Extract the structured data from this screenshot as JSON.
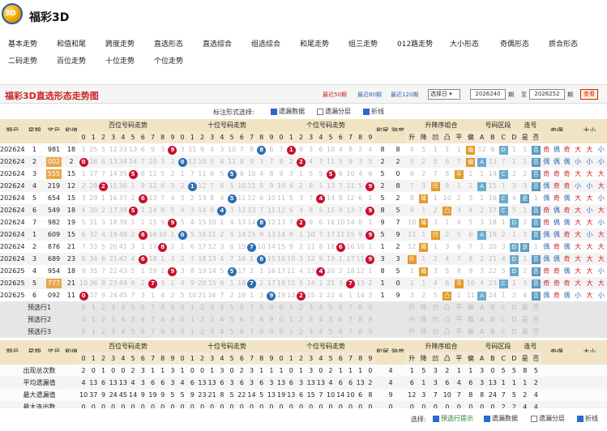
{
  "app": {
    "title": "福彩3D",
    "logo_text": "3D"
  },
  "nav": {
    "row1": [
      "基本走势",
      "和值和尾",
      "跨度走势",
      "直选形态",
      "直选综合",
      "组选综合",
      "和尾走势",
      "组三走势",
      "012路走势",
      "大小形态",
      "奇偶形态",
      "质合形态"
    ],
    "row2": [
      "二码走势",
      "百位走势",
      "十位走势",
      "个位走势"
    ]
  },
  "header": {
    "title": "福彩3D直选形态走势图",
    "periods": [
      "最近50期",
      "最近80期",
      "最近120期"
    ],
    "select_label": "选择日",
    "from_label": "期",
    "to_label": "至",
    "to_suffix": "期",
    "from": "2026240",
    "to": "2026252",
    "query": "查看"
  },
  "options": {
    "label": "标注形式选择:",
    "items": [
      {
        "label": "遗漏数据",
        "checked": true
      },
      {
        "label": "遗漏分层",
        "checked": false
      },
      {
        "label": "折线",
        "checked": true
      }
    ]
  },
  "columns": {
    "period": "期号",
    "week": "星期",
    "prize": "奖号",
    "sum": "和值",
    "hundreds": "百位号码走势",
    "tens": "十位号码走势",
    "units": "个位号码走势",
    "sum_tail": "和尾",
    "span": "跨度",
    "order": "升降序组合",
    "zone": "号码区段",
    "consec": "连号",
    "oddeven": "奇偶",
    "bigsmall": "大小",
    "digits": [
      "0",
      "1",
      "2",
      "3",
      "4",
      "5",
      "6",
      "7",
      "8",
      "9"
    ],
    "order_sub": [
      "升",
      "降",
      "凹",
      "凸",
      "平",
      "偏"
    ],
    "zone_sub": [
      "A",
      "B",
      "C",
      "D"
    ],
    "consec_sub": [
      "是",
      "否"
    ]
  },
  "rows": [
    {
      "p": "2026240",
      "w": "1",
      "n": "981",
      "s": "18",
      "h": [
        "1",
        "25",
        "5",
        "12",
        "33",
        "13",
        "6",
        "9",
        "3",
        "9"
      ],
      "t": [
        "3",
        "11",
        "9",
        "4",
        "3",
        "10",
        "7",
        "8",
        "2",
        "6"
      ],
      "u": [
        "7",
        "1",
        "9",
        "3",
        "6",
        "10",
        "4",
        "8",
        "2",
        "4"
      ],
      "hw": "8",
      "sp": "8",
      "ord": [
        "4",
        "5",
        "1",
        "1",
        "1",
        "偏"
      ],
      "zn": [
        "12",
        "6",
        "D",
        "1"
      ],
      "cs": [
        "1",
        "否"
      ],
      "oe": [
        "奇",
        "偶",
        "奇"
      ],
      "bs": [
        "大",
        "大",
        "小"
      ]
    },
    {
      "p": "2026241",
      "w": "2",
      "n": "002",
      "s": "2",
      "h": [
        "0",
        "26",
        "6",
        "13",
        "34",
        "14",
        "7",
        "10",
        "3",
        "1"
      ],
      "t": [
        "0",
        "12",
        "10",
        "5",
        "4",
        "11",
        "8",
        "9",
        "3",
        "7"
      ],
      "u": [
        "8",
        "2",
        "2",
        "4",
        "7",
        "11",
        "5",
        "9",
        "3",
        "5"
      ],
      "hw": "2",
      "sp": "2",
      "ord": [
        "5",
        "2",
        "5",
        "6",
        "7",
        "偏"
      ],
      "zn": [
        "A",
        "13",
        "7",
        "1"
      ],
      "cs": [
        "1",
        "否"
      ],
      "oe": [
        "偶",
        "偶",
        "偶"
      ],
      "bs": [
        "小",
        "小",
        "小"
      ]
    },
    {
      "p": "2026242",
      "w": "3",
      "n": "555",
      "s": "15",
      "h": [
        "1",
        "27",
        "7",
        "14",
        "35",
        "5",
        "8",
        "11",
        "5",
        "2"
      ],
      "t": [
        "1",
        "7",
        "11",
        "6",
        "5",
        "5",
        "9",
        "10",
        "4",
        "8"
      ],
      "u": [
        "9",
        "3",
        "1",
        "5",
        "5",
        "12",
        "6",
        "10",
        "4",
        "6"
      ],
      "hw": "5",
      "sp": "0",
      "ord": [
        "6",
        "2",
        "7",
        "8",
        "平",
        "1"
      ],
      "zn": [
        "1",
        "14",
        "C",
        "2"
      ],
      "cs": [
        "2",
        "否"
      ],
      "oe": [
        "奇",
        "奇",
        "奇"
      ],
      "bs": [
        "大",
        "大",
        "大"
      ]
    },
    {
      "p": "2026243",
      "w": "4",
      "n": "219",
      "s": "12",
      "h": [
        "2",
        "28",
        "2",
        "15",
        "36",
        "1",
        "9",
        "12",
        "6",
        "3"
      ],
      "t": [
        "2",
        "1",
        "12",
        "7",
        "6",
        "1",
        "10",
        "11",
        "5",
        "9"
      ],
      "u": [
        "10",
        "4",
        "2",
        "6",
        "1",
        "13",
        "7",
        "11",
        "5",
        "9"
      ],
      "hw": "2",
      "sp": "8",
      "ord": [
        "7",
        "3",
        "凹",
        "9",
        "1",
        "2"
      ],
      "zn": [
        "A",
        "15",
        "1",
        "3"
      ],
      "cs": [
        "3",
        "否"
      ],
      "oe": [
        "偶",
        "奇",
        "奇"
      ],
      "bs": [
        "小",
        "小",
        "大"
      ]
    },
    {
      "p": "2026244",
      "w": "5",
      "n": "654",
      "s": "15",
      "h": [
        "3",
        "29",
        "1",
        "16",
        "37",
        "2",
        "6",
        "13",
        "7",
        "4"
      ],
      "t": [
        "3",
        "2",
        "13",
        "8",
        "4",
        "2",
        "11",
        "12",
        "6",
        "10"
      ],
      "u": [
        "11",
        "5",
        "3",
        "7",
        "4",
        "14",
        "8",
        "12",
        "6",
        "1"
      ],
      "hw": "5",
      "sp": "2",
      "ord": [
        "8",
        "降",
        "1",
        "10",
        "2",
        "3"
      ],
      "zn": [
        "1",
        "16",
        "C",
        "4"
      ],
      "cs": [
        "是",
        "1"
      ],
      "oe": [
        "偶",
        "奇",
        "偶"
      ],
      "bs": [
        "大",
        "大",
        "小"
      ]
    },
    {
      "p": "2026245",
      "w": "6",
      "n": "549",
      "s": "18",
      "h": [
        "4",
        "30",
        "2",
        "17",
        "38",
        "5",
        "1",
        "14",
        "8",
        "5"
      ],
      "t": [
        "4",
        "3",
        "14",
        "9",
        "4",
        "3",
        "12",
        "13",
        "7",
        "11"
      ],
      "u": [
        "12",
        "6",
        "4",
        "8",
        "5",
        "15",
        "9",
        "13",
        "7",
        "9"
      ],
      "hw": "8",
      "sp": "5",
      "ord": [
        "9",
        "1",
        "2",
        "凸",
        "3",
        "4"
      ],
      "zn": [
        "2",
        "17",
        "C",
        "5"
      ],
      "cs": [
        "1",
        "否"
      ],
      "oe": [
        "奇",
        "偶",
        "奇"
      ],
      "bs": [
        "大",
        "小",
        "大"
      ]
    },
    {
      "p": "2026246",
      "w": "7",
      "n": "982",
      "s": "19",
      "h": [
        "5",
        "31",
        "3",
        "18",
        "39",
        "1",
        "2",
        "15",
        "9",
        "9"
      ],
      "t": [
        "5",
        "4",
        "15",
        "10",
        "1",
        "4",
        "13",
        "14",
        "8",
        "12"
      ],
      "u": [
        "13",
        "7",
        "2",
        "9",
        "6",
        "16",
        "10",
        "14",
        "8",
        "1"
      ],
      "hw": "9",
      "sp": "7",
      "ord": [
        "10",
        "降",
        "3",
        "1",
        "4",
        "5"
      ],
      "zn": [
        "3",
        "18",
        "1",
        "D"
      ],
      "cs": [
        "2",
        "否"
      ],
      "oe": [
        "奇",
        "偶",
        "偶"
      ],
      "bs": [
        "大",
        "大",
        "小"
      ]
    },
    {
      "p": "2026247",
      "w": "1",
      "n": "609",
      "s": "15",
      "h": [
        "6",
        "32",
        "4",
        "19",
        "40",
        "2",
        "6",
        "16",
        "10",
        "1"
      ],
      "t": [
        "0",
        "5",
        "16",
        "11",
        "2",
        "5",
        "14",
        "15",
        "9",
        "13"
      ],
      "u": [
        "14",
        "8",
        "1",
        "10",
        "7",
        "17",
        "11",
        "15",
        "9",
        "9"
      ],
      "hw": "5",
      "sp": "9",
      "ord": [
        "11",
        "1",
        "凹",
        "2",
        "5",
        "6"
      ],
      "zn": [
        "A",
        "19",
        "2",
        "1"
      ],
      "cs": [
        "3",
        "否"
      ],
      "oe": [
        "偶",
        "偶",
        "奇"
      ],
      "bs": [
        "大",
        "小",
        "大"
      ]
    },
    {
      "p": "2026248",
      "w": "2",
      "n": "876",
      "s": "21",
      "h": [
        "7",
        "33",
        "5",
        "20",
        "41",
        "3",
        "1",
        "17",
        "8",
        "2"
      ],
      "t": [
        "1",
        "6",
        "17",
        "12",
        "3",
        "6",
        "15",
        "7",
        "10",
        "14"
      ],
      "u": [
        "15",
        "9",
        "2",
        "11",
        "8",
        "18",
        "6",
        "16",
        "10",
        "1"
      ],
      "hw": "1",
      "sp": "2",
      "ord": [
        "12",
        "降",
        "1",
        "3",
        "6",
        "7"
      ],
      "zn": [
        "1",
        "20",
        "3",
        "D"
      ],
      "cs": [
        "是",
        "1"
      ],
      "oe": [
        "偶",
        "奇",
        "偶"
      ],
      "bs": [
        "大",
        "大",
        "大"
      ]
    },
    {
      "p": "2026249",
      "w": "3",
      "n": "689",
      "s": "23",
      "h": [
        "8",
        "34",
        "6",
        "21",
        "42",
        "4",
        "6",
        "18",
        "1",
        "3"
      ],
      "t": [
        "2",
        "7",
        "18",
        "13",
        "4",
        "7",
        "16",
        "1",
        "8",
        "15"
      ],
      "u": [
        "16",
        "10",
        "3",
        "12",
        "9",
        "19",
        "1",
        "17",
        "11",
        "9"
      ],
      "hw": "3",
      "sp": "3",
      "ord": [
        "升",
        "1",
        "2",
        "4",
        "7",
        "8"
      ],
      "zn": [
        "2",
        "21",
        "4",
        "D"
      ],
      "cs": [
        "1",
        "否"
      ],
      "oe": [
        "偶",
        "偶",
        "奇"
      ],
      "bs": [
        "大",
        "大",
        "大"
      ]
    },
    {
      "p": "2026250",
      "w": "4",
      "n": "954",
      "s": "18",
      "h": [
        "9",
        "35",
        "7",
        "22",
        "43",
        "5",
        "1",
        "19",
        "2",
        "9"
      ],
      "t": [
        "3",
        "8",
        "19",
        "14",
        "5",
        "5",
        "17",
        "2",
        "1",
        "16"
      ],
      "u": [
        "17",
        "11",
        "4",
        "13",
        "4",
        "20",
        "2",
        "18",
        "12",
        "1"
      ],
      "hw": "8",
      "sp": "5",
      "ord": [
        "1",
        "降",
        "3",
        "5",
        "8",
        "9"
      ],
      "zn": [
        "3",
        "22",
        "5",
        "D"
      ],
      "cs": [
        "2",
        "否"
      ],
      "oe": [
        "奇",
        "奇",
        "偶"
      ],
      "bs": [
        "大",
        "大",
        "小"
      ]
    },
    {
      "p": "2026251",
      "w": "5",
      "n": "777",
      "s": "21",
      "h": [
        "10",
        "36",
        "8",
        "23",
        "44",
        "6",
        "2",
        "7",
        "3",
        "1"
      ],
      "t": [
        "4",
        "9",
        "20",
        "15",
        "6",
        "1",
        "18",
        "7",
        "2",
        "17"
      ],
      "u": [
        "18",
        "12",
        "5",
        "14",
        "1",
        "21",
        "3",
        "7",
        "13",
        "2"
      ],
      "hw": "1",
      "sp": "0",
      "ord": [
        "2",
        "1",
        "4",
        "6",
        "平",
        "10"
      ],
      "zn": [
        "4",
        "23",
        "C",
        "1"
      ],
      "cs": [
        "3",
        "否"
      ],
      "oe": [
        "奇",
        "奇",
        "奇"
      ],
      "bs": [
        "大",
        "大",
        "大"
      ]
    },
    {
      "p": "2026252",
      "w": "6",
      "n": "092",
      "s": "11",
      "h": [
        "0",
        "37",
        "9",
        "24",
        "45",
        "7",
        "3",
        "1",
        "4",
        "2"
      ],
      "t": [
        "5",
        "10",
        "21",
        "16",
        "7",
        "2",
        "19",
        "1",
        "3",
        "9"
      ],
      "u": [
        "19",
        "13",
        "2",
        "15",
        "2",
        "22",
        "4",
        "1",
        "14",
        "3"
      ],
      "hw": "1",
      "sp": "9",
      "ord": [
        "3",
        "2",
        "5",
        "凸",
        "1",
        "11"
      ],
      "zn": [
        "A",
        "24",
        "1",
        "2"
      ],
      "cs": [
        "4",
        "否"
      ],
      "oe": [
        "偶",
        "奇",
        "偶"
      ],
      "bs": [
        "小",
        "大",
        "小"
      ]
    }
  ],
  "preselect": [
    "预选行1",
    "预选行2",
    "预选行3"
  ],
  "stats": [
    {
      "label": "出现总次数",
      "h": [
        "2",
        "0",
        "1",
        "0",
        "0",
        "2",
        "3",
        "1",
        "1",
        "3"
      ],
      "t": [
        "1",
        "0",
        "0",
        "1",
        "3",
        "0",
        "2",
        "3",
        "1",
        "1"
      ],
      "u": [
        "1",
        "0",
        "1",
        "3",
        "0",
        "2",
        "1",
        "1",
        "1",
        "0"
      ],
      "sm": [
        "4"
      ],
      "ord": [
        "1",
        "5",
        "3",
        "2",
        "1",
        "1"
      ],
      "zn": [
        "3",
        "0",
        "5",
        "5"
      ],
      "cs": [
        "8",
        "5"
      ]
    },
    {
      "label": "平均遗漏值",
      "h": [
        "4",
        "13",
        "6",
        "13",
        "13",
        "4",
        "3",
        "6",
        "6",
        "3"
      ],
      "t": [
        "4",
        "6",
        "13",
        "13",
        "6",
        "3",
        "6",
        "3",
        "6",
        "3"
      ],
      "u": [
        "13",
        "6",
        "3",
        "13",
        "13",
        "4",
        "6",
        "6",
        "13",
        "2"
      ],
      "sm": [
        "4"
      ],
      "ord": [
        "6",
        "1",
        "3",
        "6",
        "4",
        "6"
      ],
      "zn": [
        "3",
        "13",
        "1",
        "1"
      ],
      "cs": [
        "1",
        "2"
      ]
    },
    {
      "label": "最大遗漏值",
      "h": [
        "10",
        "37",
        "9",
        "24",
        "45",
        "14",
        "9",
        "19",
        "9",
        "5"
      ],
      "t": [
        "5",
        "9",
        "23",
        "21",
        "8",
        "5",
        "22",
        "14",
        "5",
        "13"
      ],
      "u": [
        "19",
        "13",
        "6",
        "15",
        "7",
        "10",
        "14",
        "10",
        "6",
        "8"
      ],
      "sm": [
        "9"
      ],
      "ord": [
        "12",
        "3",
        "7",
        "10",
        "7",
        "8"
      ],
      "zn": [
        "8",
        "24",
        "7",
        "5"
      ],
      "cs": [
        "2",
        "4"
      ]
    },
    {
      "label": "最大连出数",
      "h": [
        "0",
        "0",
        "0",
        "0",
        "0",
        "0",
        "0",
        "0",
        "0",
        "0"
      ],
      "t": [
        "0",
        "0",
        "0",
        "0",
        "0",
        "0",
        "0",
        "0",
        "0",
        "0"
      ],
      "u": [
        "0",
        "0",
        "0",
        "0",
        "0",
        "0",
        "0",
        "0",
        "0",
        "0"
      ],
      "sm": [
        "0"
      ],
      "ord": [
        "0",
        "0",
        "0",
        "0",
        "0",
        "0"
      ],
      "zn": [
        "0",
        "0",
        "2",
        "2"
      ],
      "cs": [
        "4",
        "4"
      ]
    }
  ],
  "bottom": {
    "label": "选择:",
    "items": [
      {
        "label": "预选行提示",
        "checked": true,
        "color": "#2a7a2a"
      },
      {
        "label": "遗漏数据",
        "checked": true
      },
      {
        "label": "遗漏分层",
        "checked": false
      },
      {
        "label": "折线",
        "checked": true
      }
    ]
  },
  "colors": {
    "red": "#c8102e",
    "blue": "#2d6db2",
    "header_bg": "#f1e4c4",
    "title": "#cc2222"
  }
}
